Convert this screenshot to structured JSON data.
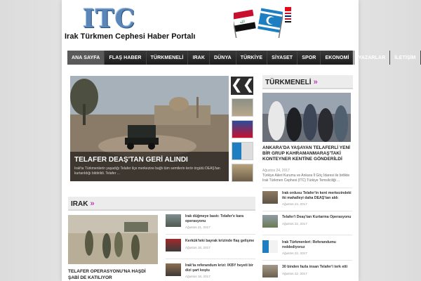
{
  "header": {
    "logo_letters": "ITC",
    "subtitle": "Irak Türkmen Cephesi Haber Portalı"
  },
  "nav": {
    "items": [
      "ANA SAYFA",
      "FLAŞ HABER",
      "TÜRKMENELİ",
      "IRAK",
      "DÜNYA",
      "TÜRKİYE",
      "SİYASET",
      "SPOR",
      "EKONOMİ",
      "YAZARLAR",
      "İLETİŞİM"
    ]
  },
  "slider": {
    "title": "TELAFER DEAŞ'TAN GERİ ALINDI",
    "text": "Irak'ta Türkmenlerin yaşadığı Telafer ilçe merkezine bağlı tüm semtlerin terör örgütü DEAŞ'tan kurtarıldığı bildirildi. Telafer ...",
    "arrow": "❮❮"
  },
  "turkmeneli": {
    "header": "TÜRKMENELİ",
    "arrow": "»",
    "featured": {
      "title": "ANKARA'DA YAŞAYAN TELAFERLİ YENİ BİR GRUP KAHRAMANMARAŞ'TAKİ KONTEYNER KENTİNE GÖNDERİLDİ",
      "date": "Ağustos 24, 2017",
      "text": "Türkiye Aileri Kurumu ve Ankara İl Göç İdaresi ile birlikte Irak Türkmen Cephesi (ITC) Türkiye Temsilciliği ..."
    },
    "items": [
      {
        "title": "Irak ordusu Telafer'in kent merkezindeki iki mahalleyi daha DEAŞ'tan aldı",
        "date": "Ağustos 24, 2017"
      },
      {
        "title": "Telafer'i Deaş'tan Kurtarma Operasyonu",
        "date": "Ağustos 22, 2017"
      },
      {
        "title": "Irak Türkmenleri: Referandumu reddediyoruz",
        "date": "Ağustos 22, 2017"
      },
      {
        "title": "30 binden fazla insan Telafer'i terk etti",
        "date": "Ağustos 22, 2017"
      }
    ]
  },
  "irak": {
    "header": "IRAK",
    "arrow": "»",
    "featured_title": "TELAFER OPERASYONU'NA HAŞDİ ŞABİ DE KATILIYOR",
    "items": [
      {
        "title": "Irak düğmeye bastı: Telafer'e kara operasyonu",
        "date": "Ağustos 21, 2017"
      },
      {
        "title": "Kerkük'teki bayrak krizinde flaş gelişme",
        "date": "Ağustos 18, 2017"
      },
      {
        "title": "Irak'ta referandum krizi: IKBY heyeti bir dizi şart koştu",
        "date": "Ağustos 18, 2017"
      }
    ]
  }
}
